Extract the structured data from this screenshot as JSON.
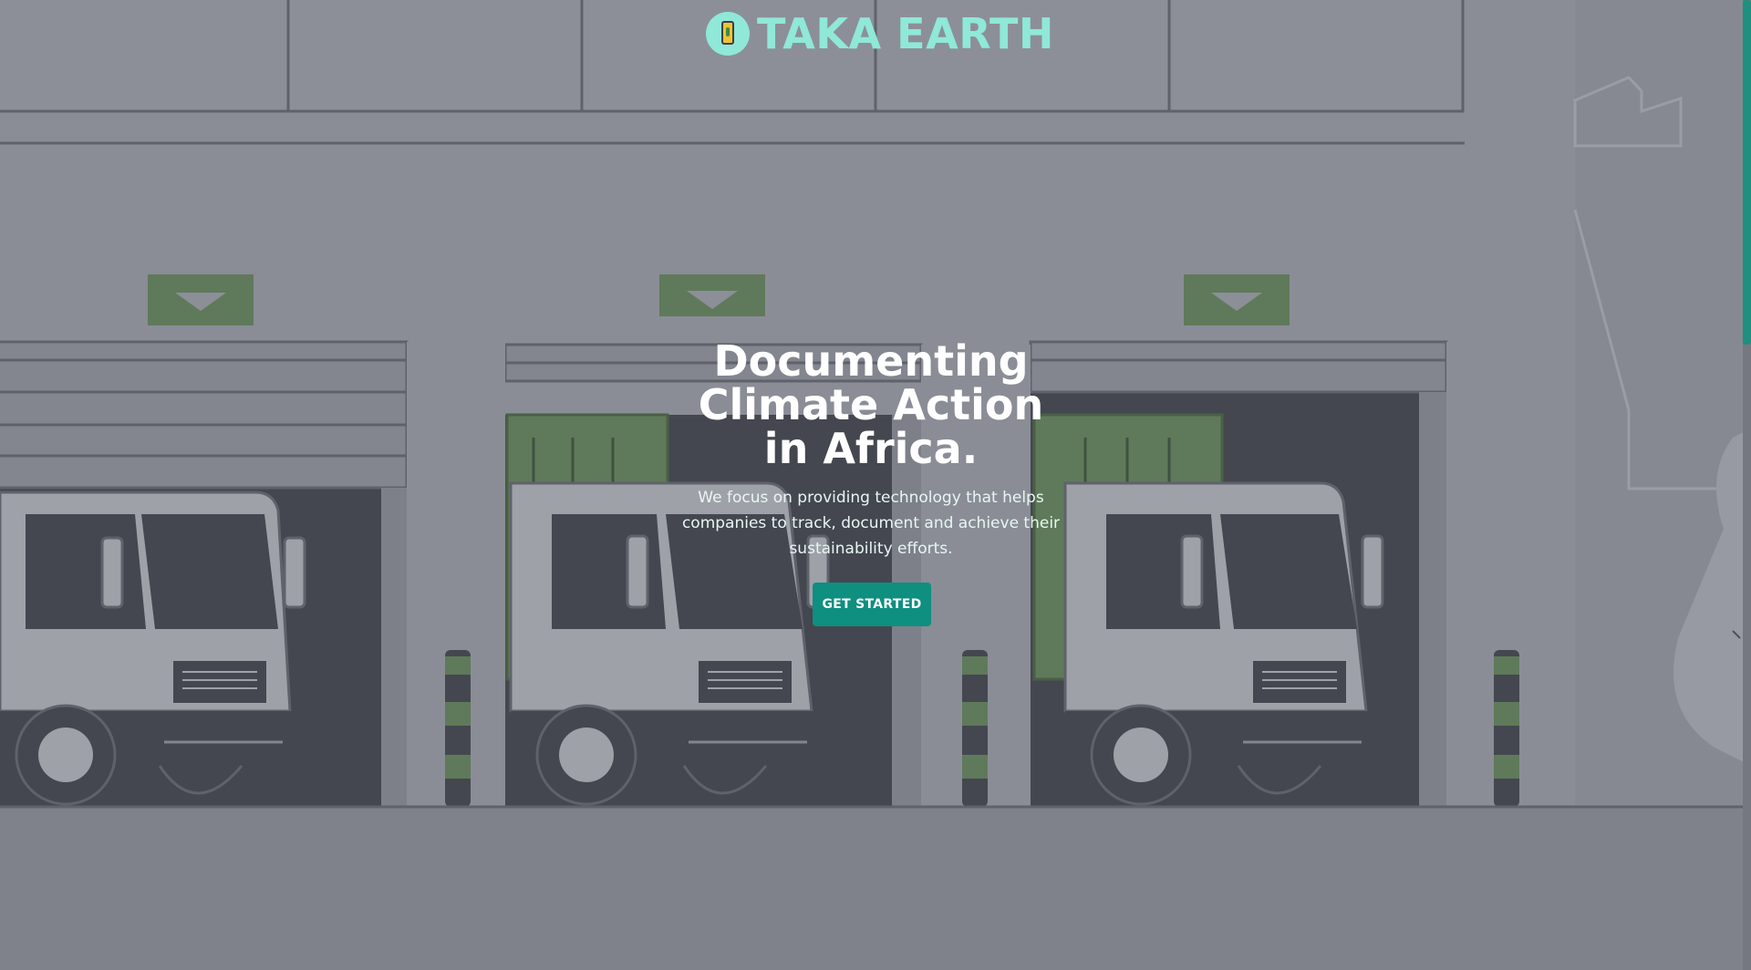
{
  "brand": {
    "name": "TAKA EARTH",
    "logo_icon": "phone-leaf-icon",
    "color": "#8fe8d8"
  },
  "hero": {
    "title": "Documenting Climate Action in Africa.",
    "subtitle": "We focus on providing technology that helps companies to track, document and achieve their sustainability efforts.",
    "cta_label": "GET STARTED"
  },
  "colors": {
    "accent": "#0f8f80",
    "background": "#7f828a",
    "scrollbar_thumb": "#1f8f7f"
  },
  "background_scene": {
    "description_icon": "warehouse-loading-dock-illustration",
    "icons": [
      "truck-icon",
      "door-arrow-icon",
      "bollard-icon"
    ]
  },
  "scroll": {
    "indicator_icon": "chevron-down-icon"
  }
}
